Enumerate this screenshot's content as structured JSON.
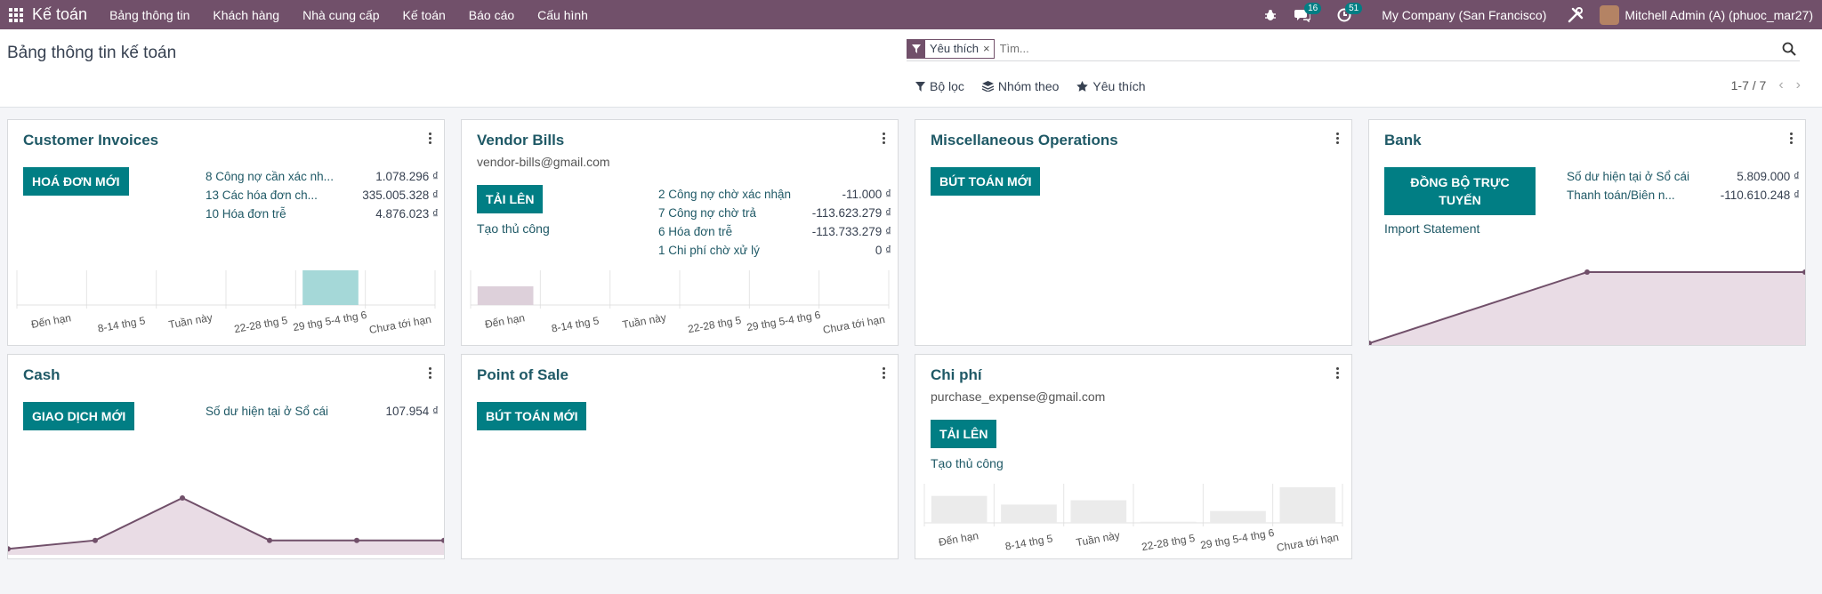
{
  "nav": {
    "brand": "Kế toán",
    "menu": [
      "Bảng thông tin",
      "Khách hàng",
      "Nhà cung cấp",
      "Kế toán",
      "Báo cáo",
      "Cấu hình"
    ],
    "messages_count": "16",
    "activities_count": "51",
    "company": "My Company (San Francisco)",
    "user": "Mitchell Admin (A) (phuoc_mar27)"
  },
  "control": {
    "title": "Bảng thông tin kế toán",
    "facet": "Yêu thích",
    "search_placeholder": "Tìm...",
    "filters": [
      "Bộ lọc",
      "Nhóm theo",
      "Yêu thích"
    ],
    "pager": "1-7 / 7"
  },
  "cards": {
    "customer_invoices": {
      "title": "Customer Invoices",
      "button": "HOÁ ĐƠN MỚI",
      "stats": [
        {
          "label": "8 Công nợ cần xác nh...",
          "value": "1.078.296 ₫"
        },
        {
          "label": "13 Các hóa đơn ch...",
          "value": "335.005.328 ₫"
        },
        {
          "label": "10 Hóa đơn trễ",
          "value": "4.876.023 ₫"
        }
      ]
    },
    "vendor_bills": {
      "title": "Vendor Bills",
      "email": "vendor-bills@gmail.com",
      "button": "TẢI LÊN",
      "link": "Tạo thủ công",
      "stats": [
        {
          "label": "2 Công nợ chờ xác nhận",
          "value": "-11.000 ₫"
        },
        {
          "label": "7 Công nợ chờ trả",
          "value": "-113.623.279 ₫"
        },
        {
          "label": "6 Hóa đơn trễ",
          "value": "-113.733.279 ₫"
        },
        {
          "label": "1 Chi phí chờ xử lý",
          "value": "0 ₫"
        }
      ]
    },
    "misc": {
      "title": "Miscellaneous Operations",
      "button": "BÚT TOÁN MỚI"
    },
    "bank": {
      "title": "Bank",
      "button": "ĐỒNG BỘ TRỰC TUYẾN",
      "link": "Import Statement",
      "stats": [
        {
          "label": "Số dư hiện tại ở Sổ cái",
          "value": "5.809.000 ₫"
        },
        {
          "label": "Thanh toán/Biên n...",
          "value": "-110.610.248 ₫"
        }
      ]
    },
    "cash": {
      "title": "Cash",
      "button": "GIAO DỊCH MỚI",
      "stats": [
        {
          "label": "Số dư hiện tại ở Sổ cái",
          "value": "107.954 ₫"
        }
      ]
    },
    "pos": {
      "title": "Point of Sale",
      "button": "BÚT TOÁN MỚI"
    },
    "expenses": {
      "title": "Chi phí",
      "email": "purchase_expense@gmail.com",
      "button": "TẢI LÊN",
      "link": "Tạo thủ công"
    }
  },
  "chart_data": [
    {
      "type": "bar",
      "card": "Customer Invoices",
      "categories": [
        "Đến hạn",
        "8-14 thg 5",
        "Tuần này",
        "22-28 thg 5",
        "29 thg 5-4 thg 6",
        "Chưa tới hạn"
      ],
      "values": [
        0,
        0,
        0,
        0,
        4876023,
        0
      ],
      "color": "#a5d8d8"
    },
    {
      "type": "bar",
      "card": "Vendor Bills",
      "categories": [
        "Đến hạn",
        "8-14 thg 5",
        "Tuần này",
        "22-28 thg 5",
        "29 thg 5-4 thg 6",
        "Chưa tới hạn"
      ],
      "values": [
        113733279,
        0,
        0,
        0,
        0,
        0
      ],
      "color": "#ddd0da"
    },
    {
      "type": "bar",
      "card": "Chi phí",
      "categories": [
        "Đến hạn",
        "8-14 thg 5",
        "Tuần này",
        "22-28 thg 5",
        "29 thg 5-4 thg 6",
        "Chưa tới hạn"
      ],
      "values": [
        25,
        17,
        21,
        1,
        11,
        33
      ],
      "color": "#ebebeb"
    },
    {
      "type": "area",
      "card": "Bank",
      "values": [
        0,
        1,
        1
      ],
      "color": "#71506a"
    },
    {
      "type": "area",
      "card": "Cash",
      "values": [
        0.2,
        0.6,
        2.6,
        0.6,
        0.6,
        0.6
      ],
      "color": "#71506a"
    }
  ],
  "colors": {
    "brand": "#71506a",
    "primary": "#017e84",
    "title": "#1f5966"
  }
}
